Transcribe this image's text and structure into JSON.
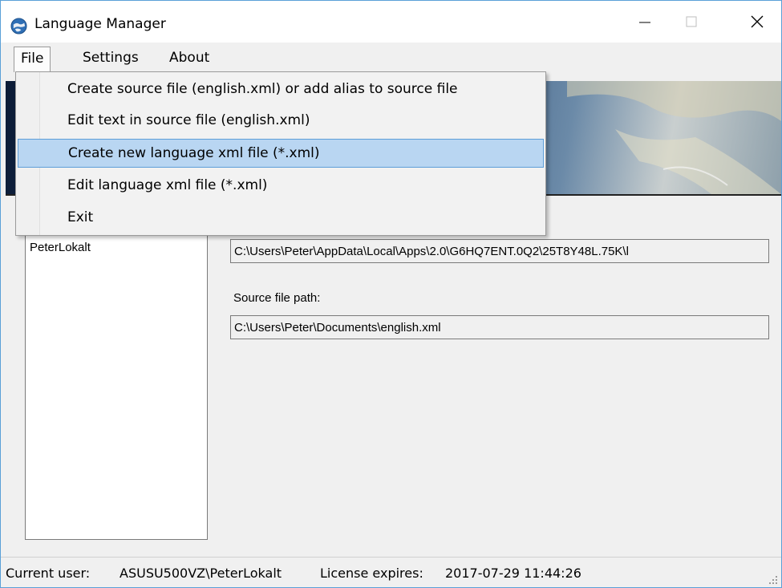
{
  "window": {
    "title": "Language Manager"
  },
  "menu": {
    "file": "File",
    "settings": "Settings",
    "about": "About"
  },
  "file_menu": {
    "items": [
      {
        "label": "Create source file (english.xml) or add alias to source file"
      },
      {
        "label": "Edit text in source file (english.xml)"
      },
      {
        "label": "Create new language xml file (*.xml)",
        "highlighted": true
      },
      {
        "label": "Edit language xml file (*.xml)"
      },
      {
        "label": "Exit"
      }
    ]
  },
  "users_list": {
    "items": [
      "PeterLokalt"
    ]
  },
  "paths": {
    "app_data_path": "C:\\Users\\Peter\\AppData\\Local\\Apps\\2.0\\G6HQ7ENT.0Q2\\25T8Y48L.75K\\l",
    "source_file_label": "Source file path:",
    "source_file_path": "C:\\Users\\Peter\\Documents\\english.xml"
  },
  "status": {
    "user_label": "Current user:",
    "user_value": "ASUSU500VZ\\PeterLokalt",
    "license_label": "License expires:",
    "license_value": "2017-07-29 11:44:26"
  },
  "colors": {
    "highlight": "#b9d6f2",
    "highlight_border": "#5e9ed8",
    "window_border": "#5aa0d8"
  }
}
